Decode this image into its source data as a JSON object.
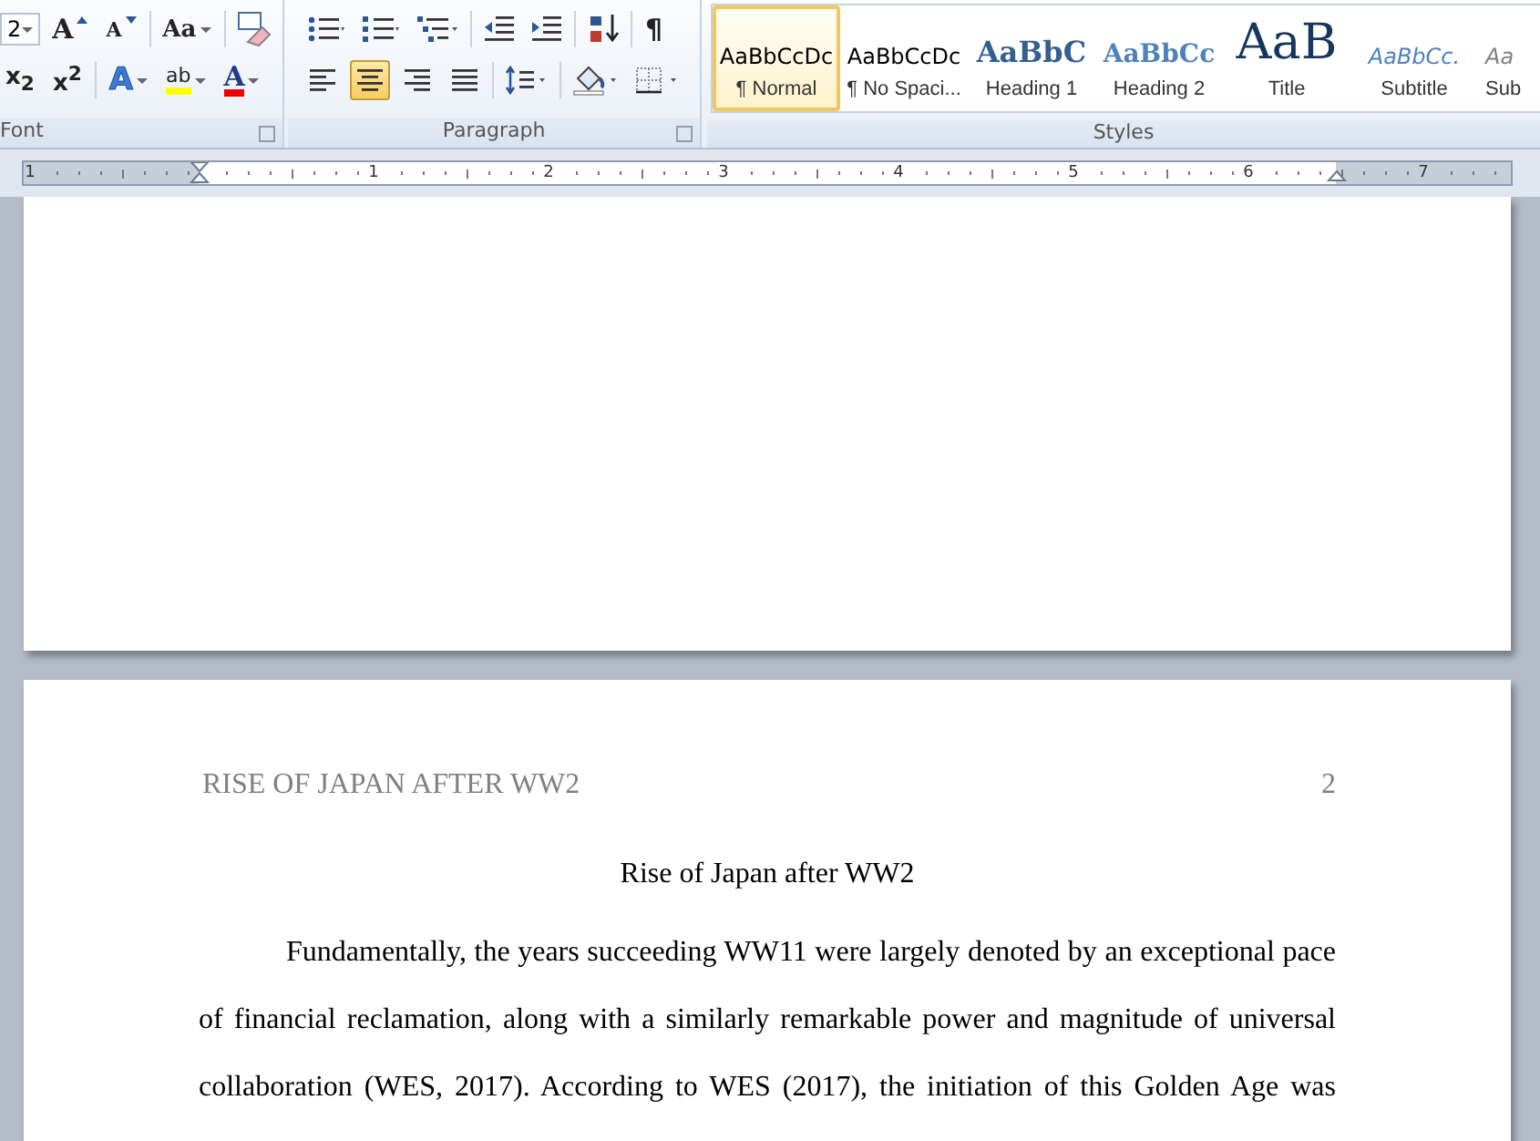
{
  "ribbon": {
    "font_group": {
      "font_size": "2",
      "label": "Font",
      "row1": [
        {
          "kind": "grow_font",
          "glyph": "A"
        },
        {
          "kind": "shrink_font",
          "glyph": "A"
        },
        {
          "kind": "change_case",
          "glyph": "Aa"
        },
        {
          "kind": "clear_formatting"
        }
      ],
      "row2": [
        {
          "kind": "subscript",
          "glyph": "x$_{2}$"
        },
        {
          "kind": "superscript",
          "glyph": "x$^{2}$"
        },
        {
          "kind": "text_effects",
          "glyph": "A"
        },
        {
          "kind": "highlight",
          "glyph": "ab"
        },
        {
          "kind": "font_color",
          "glyph": "A"
        }
      ]
    },
    "paragraph_group": {
      "label": "Paragraph",
      "row1": [
        {
          "kind": "bullets"
        },
        {
          "kind": "numbering"
        },
        {
          "kind": "multilevel"
        },
        {
          "kind": "decrease_indent"
        },
        {
          "kind": "increase_indent"
        },
        {
          "kind": "sort"
        },
        {
          "kind": "show_marks",
          "glyph": "¶"
        }
      ],
      "alignment": [
        {
          "kind": "left",
          "selected": false
        },
        {
          "kind": "center",
          "selected": true
        },
        {
          "kind": "right",
          "selected": false
        },
        {
          "kind": "justify",
          "selected": false
        }
      ],
      "row2": [
        {
          "kind": "line_spacing"
        },
        {
          "kind": "shading"
        },
        {
          "kind": "borders"
        }
      ]
    },
    "styles_group": {
      "label": "Styles",
      "items": [
        {
          "kind": "normal",
          "sample": "AaBbCcDc",
          "name": "¶ Normal",
          "selected": true
        },
        {
          "kind": "no_spacing",
          "sample": "AaBbCcDc",
          "name": "¶ No Spaci...",
          "selected": false
        },
        {
          "kind": "heading1",
          "sample": "AaBbC",
          "name": "Heading 1",
          "selected": false
        },
        {
          "kind": "heading2",
          "sample": "AaBbCc",
          "name": "Heading 2",
          "selected": false
        },
        {
          "kind": "title",
          "sample": "AaB",
          "name": "Title",
          "selected": false
        },
        {
          "kind": "subtitle",
          "sample": "AaBbCc.",
          "name": "Subtitle",
          "selected": false
        },
        {
          "kind": "subtle",
          "sample": "Aa",
          "name": "Sub",
          "selected": false
        }
      ]
    }
  },
  "ruler": {
    "numbers": [
      "1",
      "1",
      "2",
      "3",
      "4",
      "5",
      "6",
      "7"
    ]
  },
  "pages": [
    {
      "kind": "blank"
    },
    {
      "kind": "text",
      "header": "RISE OF JAPAN AFTER WW2",
      "page_number": "2",
      "title": "Rise of Japan after WW2",
      "paragraph": "Fundamentally, the years succeeding WW11 were largely denoted by an exceptional pace of financial reclamation, along with a similarly remarkable power and magnitude of universal collaboration (WES, 2017). According to WES (2017), the initiation of this Golden Age was"
    }
  ]
}
